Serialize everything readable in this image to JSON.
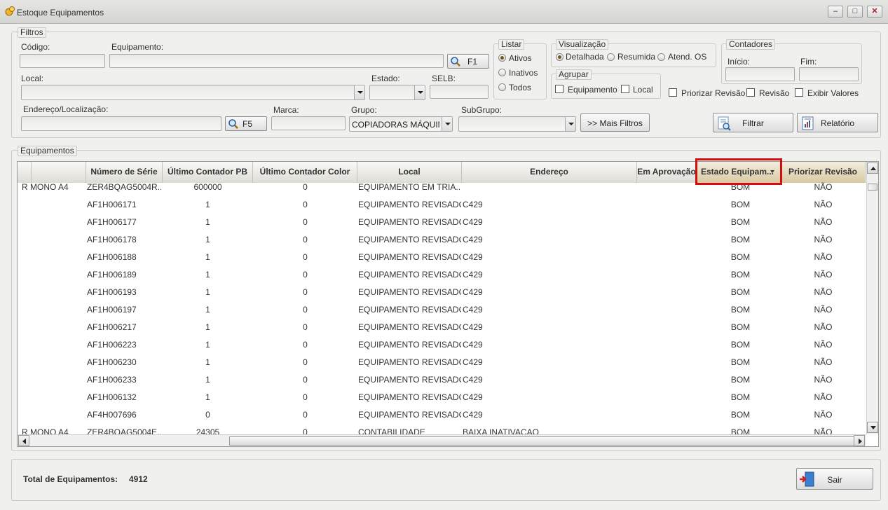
{
  "window": {
    "title": "Estoque Equipamentos",
    "min_symbol": "–",
    "max_symbol": "□",
    "close_symbol": "✕"
  },
  "filters": {
    "legend": "Filtros",
    "codigo_label": "Código:",
    "codigo_value": "",
    "equipamento_label": "Equipamento:",
    "equipamento_value": "",
    "f1_label": "F1",
    "local_label": "Local:",
    "local_value": "",
    "estado_label": "Estado:",
    "estado_value": "",
    "selb_label": "SELB:",
    "selb_value": "",
    "endereco_label": "Endereço/Localização:",
    "endereco_value": "",
    "f5_label": "F5",
    "marca_label": "Marca:",
    "marca_value": "",
    "grupo_label": "Grupo:",
    "grupo_value": "COPIADORAS MÁQUIN",
    "subgrupo_label": "SubGrupo:",
    "subgrupo_value": "",
    "mais_filtros_label": ">> Mais Filtros",
    "listar": {
      "legend": "Listar",
      "ativos": "Ativos",
      "inativos": "Inativos",
      "todos": "Todos"
    },
    "visualizacao": {
      "legend": "Visualização",
      "detalhada": "Detalhada",
      "resumida": "Resumida",
      "atend_os": "Atend. OS"
    },
    "agrupar": {
      "legend": "Agrupar",
      "equipamento": "Equipamento",
      "local": "Local"
    },
    "contadores": {
      "legend": "Contadores",
      "inicio_label": "Início:",
      "fim_label": "Fim:"
    },
    "priorizar_revisao": "Priorizar Revisão",
    "revisao": "Revisão",
    "exibir_valores": "Exibir Valores",
    "filtrar_label": "Filtrar",
    "relatorio_label": "Relatório"
  },
  "equipamentos": {
    "legend": "Equipamentos",
    "columns": [
      "",
      "Número de Série",
      "Último Contador PB",
      "Último Contador Color",
      "Local",
      "Endereço",
      "Em Aprovação",
      "Estado Equipam...",
      "Priorizar Revisão"
    ],
    "rows": [
      {
        "c0": "R MONO A4",
        "serie": "ZER4BQAG5004R...",
        "pb": "600000",
        "color": "0",
        "local": "EQUIPAMENTO  EM  TRIA...",
        "endereco": "",
        "estado": "BOM",
        "priorizar": "NÃO"
      },
      {
        "c0": "",
        "serie": "AF1H006171",
        "pb": "1",
        "color": "0",
        "local": "EQUIPAMENTO REVISADO",
        "endereco": "C429",
        "estado": "BOM",
        "priorizar": "NÃO"
      },
      {
        "c0": "",
        "serie": "AF1H006177",
        "pb": "1",
        "color": "0",
        "local": "EQUIPAMENTO REVISADO",
        "endereco": "C429",
        "estado": "BOM",
        "priorizar": "NÃO"
      },
      {
        "c0": "",
        "serie": "AF1H006178",
        "pb": "1",
        "color": "0",
        "local": "EQUIPAMENTO REVISADO",
        "endereco": "C429",
        "estado": "BOM",
        "priorizar": "NÃO"
      },
      {
        "c0": "",
        "serie": "AF1H006188",
        "pb": "1",
        "color": "0",
        "local": "EQUIPAMENTO REVISADO",
        "endereco": "C429",
        "estado": "BOM",
        "priorizar": "NÃO"
      },
      {
        "c0": "",
        "serie": "AF1H006189",
        "pb": "1",
        "color": "0",
        "local": "EQUIPAMENTO REVISADO",
        "endereco": "C429",
        "estado": "BOM",
        "priorizar": "NÃO"
      },
      {
        "c0": "",
        "serie": "AF1H006193",
        "pb": "1",
        "color": "0",
        "local": "EQUIPAMENTO REVISADO",
        "endereco": "C429",
        "estado": "BOM",
        "priorizar": "NÃO"
      },
      {
        "c0": "",
        "serie": "AF1H006197",
        "pb": "1",
        "color": "0",
        "local": "EQUIPAMENTO REVISADO",
        "endereco": "C429",
        "estado": "BOM",
        "priorizar": "NÃO"
      },
      {
        "c0": "",
        "serie": "AF1H006217",
        "pb": "1",
        "color": "0",
        "local": "EQUIPAMENTO REVISADO",
        "endereco": "C429",
        "estado": "BOM",
        "priorizar": "NÃO"
      },
      {
        "c0": "",
        "serie": "AF1H006223",
        "pb": "1",
        "color": "0",
        "local": "EQUIPAMENTO REVISADO",
        "endereco": "C429",
        "estado": "BOM",
        "priorizar": "NÃO"
      },
      {
        "c0": "",
        "serie": "AF1H006230",
        "pb": "1",
        "color": "0",
        "local": "EQUIPAMENTO REVISADO",
        "endereco": "C429",
        "estado": "BOM",
        "priorizar": "NÃO"
      },
      {
        "c0": "",
        "serie": "AF1H006233",
        "pb": "1",
        "color": "0",
        "local": "EQUIPAMENTO REVISADO",
        "endereco": "C429",
        "estado": "BOM",
        "priorizar": "NÃO"
      },
      {
        "c0": "",
        "serie": "AF1H006132",
        "pb": "1",
        "color": "0",
        "local": "EQUIPAMENTO REVISADO",
        "endereco": "C429",
        "estado": "BOM",
        "priorizar": "NÃO"
      },
      {
        "c0": "",
        "serie": "AF4H007696",
        "pb": "0",
        "color": "0",
        "local": "EQUIPAMENTO REVISADO",
        "endereco": "C429",
        "estado": "BOM",
        "priorizar": "NÃO"
      },
      {
        "c0": "R MONO A4",
        "serie": "ZER4BQAG5004E...",
        "pb": "24305",
        "color": "0",
        "local": "CONTABILIDADE",
        "endereco": "BAIXA INATIVACAO",
        "estado": "BOM",
        "priorizar": "NÃO"
      }
    ]
  },
  "footer": {
    "total_label": "Total de Equipamentos:",
    "total_value": "4912",
    "sair_label": "Sair"
  }
}
